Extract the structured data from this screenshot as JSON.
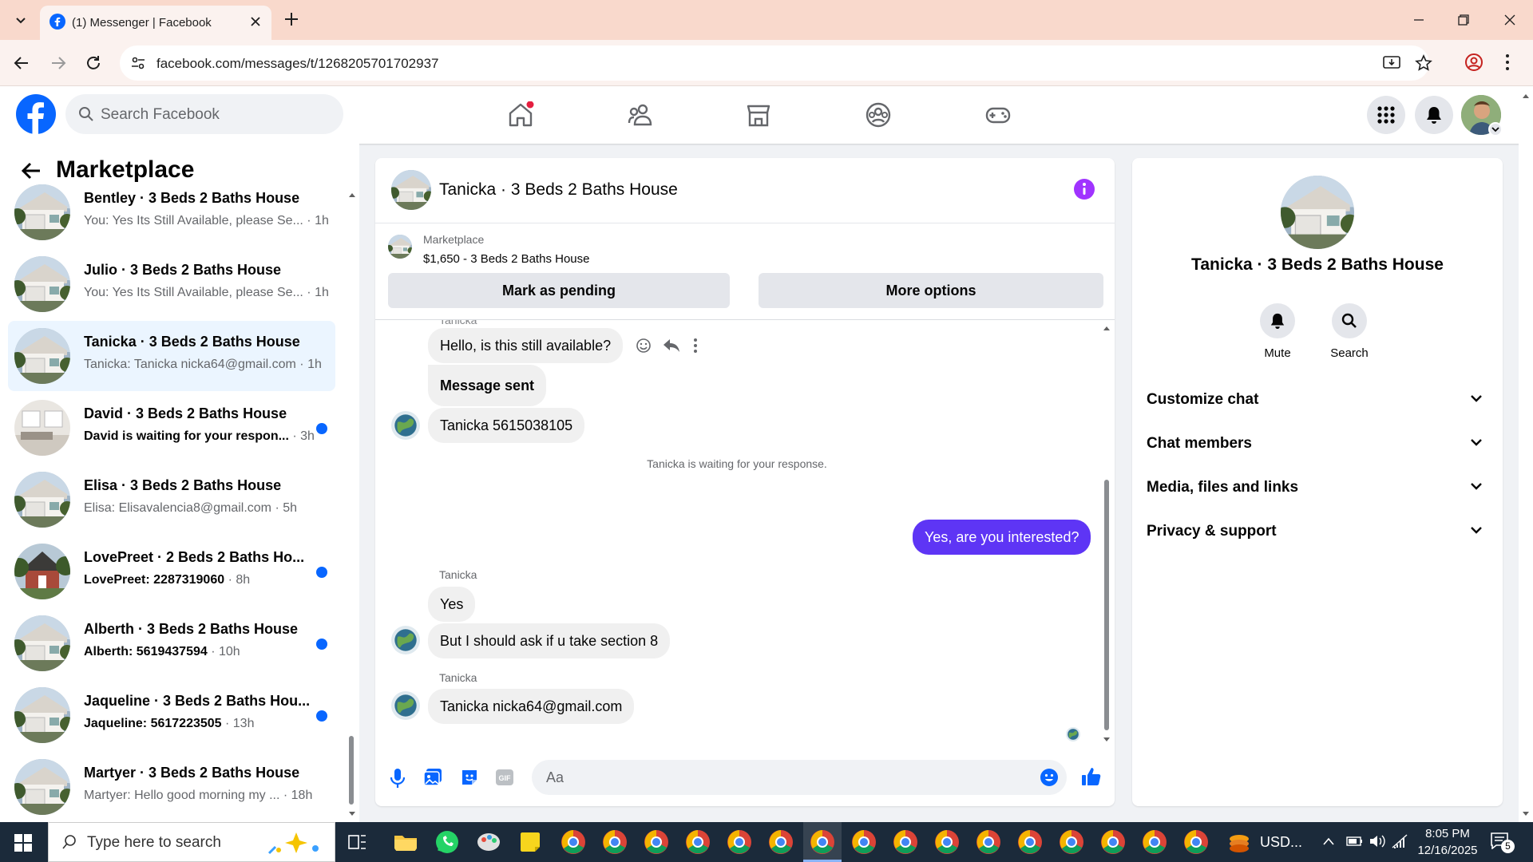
{
  "browser": {
    "tab_title": "(1) Messenger | Facebook",
    "url": "facebook.com/messages/t/1268205701702937"
  },
  "fb": {
    "search_placeholder": "Search Facebook"
  },
  "left_panel": {
    "title": "Marketplace",
    "conversations": [
      {
        "name": "Bentley · 3 Beds 2 Baths House",
        "preview": "You: Yes Its Still Available, please Se...",
        "time": "1h",
        "unread": false,
        "active": false
      },
      {
        "name": "Julio · 3 Beds 2 Baths House",
        "preview": "You: Yes Its Still Available, please Se...",
        "time": "1h",
        "unread": false,
        "active": false
      },
      {
        "name": "Tanicka · 3 Beds 2 Baths House",
        "preview": "Tanicka: Tanicka nicka64@gmail.com",
        "time": "1h",
        "unread": false,
        "active": true
      },
      {
        "name": "David · 3 Beds 2 Baths House",
        "preview": "David is waiting for your respon...",
        "time": "3h",
        "unread": true,
        "active": false
      },
      {
        "name": "Elisa · 3 Beds 2 Baths House",
        "preview": "Elisa: Elisavalencia8@gmail.com",
        "time": "5h",
        "unread": false,
        "active": false
      },
      {
        "name": "LovePreet · 2 Beds 2 Baths Ho...",
        "preview": "LovePreet: 2287319060",
        "time": "8h",
        "unread": true,
        "active": false
      },
      {
        "name": "Alberth · 3 Beds 2 Baths House",
        "preview": "Alberth: 5619437594",
        "time": "10h",
        "unread": true,
        "active": false
      },
      {
        "name": "Jaqueline · 3 Beds 2 Baths Hou...",
        "preview": "Jaqueline: 5617223505",
        "time": "13h",
        "unread": true,
        "active": false
      },
      {
        "name": "Martyer · 3 Beds 2 Baths House",
        "preview": "Martyer: Hello good morning my ...",
        "time": "18h",
        "unread": false,
        "active": false
      }
    ]
  },
  "chat": {
    "title": "Tanicka · 3 Beds 2 Baths House",
    "marketplace_label": "Marketplace",
    "listing": "$1,650 - 3 Beds 2 Baths House",
    "btn_pending": "Mark as pending",
    "btn_more": "More options",
    "sender_name": "Tanicka",
    "messages": {
      "m1": "Hello, is this still available?",
      "m2": "Message sent",
      "m3": "Tanicka 5615038105",
      "system": "Tanicka is waiting for your response.",
      "m4": "Yes, are you interested?",
      "m5": "Yes",
      "m6": "But I should ask if u take section 8",
      "m7": "Tanicka nicka64@gmail.com"
    },
    "input_placeholder": "Aa"
  },
  "right_panel": {
    "name": "Tanicka · 3 Beds 2 Baths House",
    "mute": "Mute",
    "search": "Search",
    "sections": [
      "Customize chat",
      "Chat members",
      "Media, files and links",
      "Privacy & support"
    ]
  },
  "taskbar": {
    "search_placeholder": "Type here to search",
    "weather": "USD...",
    "time": "8:05 PM",
    "date": "12/16/2025",
    "notif_count": "5"
  },
  "colors": {
    "fb_blue": "#0866ff",
    "my_bubble": "#5e35f5",
    "unread_dot": "#0866ff",
    "info_icon": "#a033ff"
  }
}
